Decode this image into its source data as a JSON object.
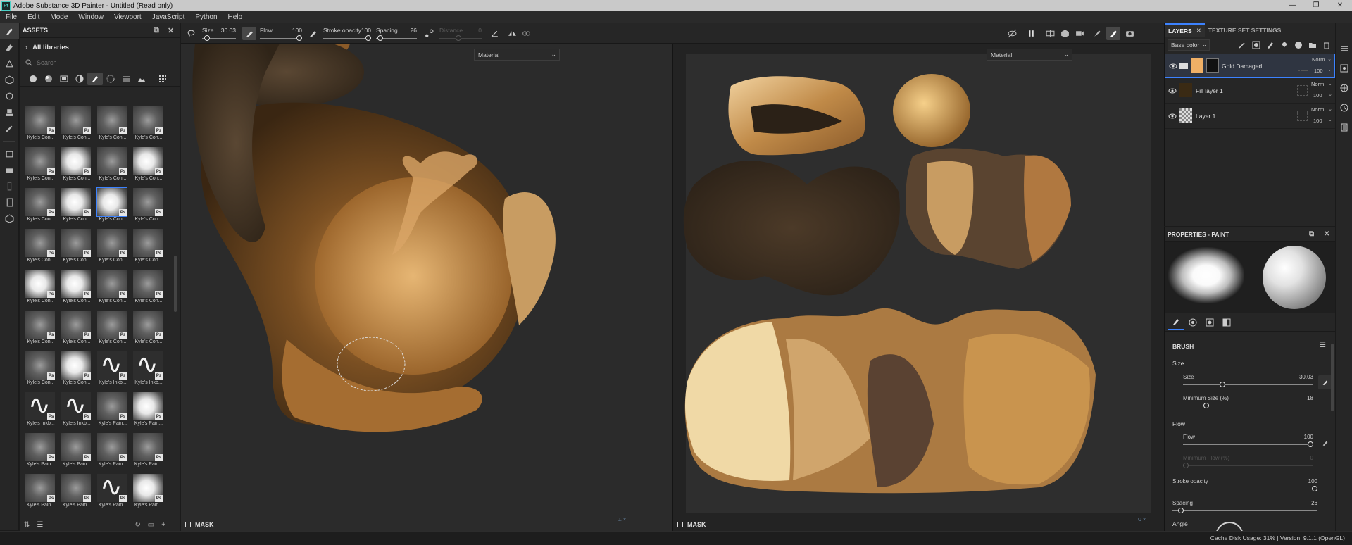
{
  "window": {
    "title": "Adobe Substance 3D Painter - Untitled (Read only)",
    "app_icon": "Pt",
    "controls": [
      "—",
      "❐",
      "✕"
    ]
  },
  "menu": [
    "File",
    "Edit",
    "Mode",
    "Window",
    "Viewport",
    "JavaScript",
    "Python",
    "Help"
  ],
  "assets": {
    "title": "ASSETS",
    "library": "All libraries",
    "search_placeholder": "Search",
    "ps_badge": "Ps",
    "rows": [
      [
        "Kyle's Con...",
        "Kyle's Con...",
        "Kyle's Con...",
        "Kyle's Con..."
      ],
      [
        "Kyle's Con...",
        "Kyle's Con...",
        "Kyle's Con...",
        "Kyle's Con..."
      ],
      [
        "Kyle's Con...",
        "Kyle's Con...",
        "Kyle's Con...",
        "Kyle's Con..."
      ],
      [
        "Kyle's Con...",
        "Kyle's Con...",
        "Kyle's Con...",
        "Kyle's Con..."
      ],
      [
        "Kyle's Con...",
        "Kyle's Con...",
        "Kyle's Con...",
        "Kyle's Con..."
      ],
      [
        "Kyle's Con...",
        "Kyle's Con...",
        "Kyle's Con...",
        "Kyle's Con..."
      ],
      [
        "Kyle's Con...",
        "Kyle's Con...",
        "Kyle's Inkb...",
        "Kyle's Inkb..."
      ],
      [
        "Kyle's Inkb...",
        "Kyle's Inkb...",
        "Kyle's Pain...",
        "Kyle's Pain..."
      ],
      [
        "Kyle's Pain...",
        "Kyle's Pain...",
        "Kyle's Pain...",
        "Kyle's Pain..."
      ],
      [
        "Kyle's Pain...",
        "Kyle's Pain...",
        "Kyle's Pain...",
        "Kyle's Pain..."
      ]
    ]
  },
  "toolbar": {
    "size": {
      "label": "Size",
      "value": "30.03",
      "fraction": 0.15
    },
    "flow": {
      "label": "Flow",
      "value": "100",
      "fraction": 1.0
    },
    "stroke_opacity": {
      "label": "Stroke opacity",
      "value": "100",
      "fraction": 1.0
    },
    "spacing": {
      "label": "Spacing",
      "value": "26",
      "fraction": 0.1
    },
    "distance": {
      "label": "Distance",
      "value": "0",
      "fraction": 0.45
    }
  },
  "viewport3d": {
    "dropdown": "Material",
    "mask": "MASK"
  },
  "viewport2d": {
    "dropdown": "Material",
    "mask": "MASK"
  },
  "layers": {
    "tab_layers": "LAYERS",
    "tab_texture": "TEXTURE SET SETTINGS",
    "channel": "Base color",
    "items": [
      {
        "name": "Gold Damaged",
        "blend": "Norm",
        "opacity": "100",
        "swatch": "#f0b066"
      },
      {
        "name": "Fill layer 1",
        "blend": "Norm",
        "opacity": "100",
        "swatch": "#3a2a14"
      },
      {
        "name": "Layer 1",
        "blend": "Norm",
        "opacity": "100",
        "swatch": "checker"
      }
    ]
  },
  "properties": {
    "title": "PROPERTIES - PAINT",
    "brush_section": "BRUSH",
    "size_group": "Size",
    "size": {
      "label": "Size",
      "value": "30.03",
      "fraction": 0.3
    },
    "min_size": {
      "label": "Minimum Size (%)",
      "value": "18",
      "fraction": 0.18
    },
    "flow_group": "Flow",
    "flow": {
      "label": "Flow",
      "value": "100",
      "fraction": 1.0
    },
    "min_flow": {
      "label": "Minimum Flow (%)",
      "value": "0",
      "fraction": 0.0
    },
    "stroke_opacity": {
      "label": "Stroke opacity",
      "value": "100",
      "fraction": 1.0
    },
    "spacing": {
      "label": "Spacing",
      "value": "26",
      "fraction": 0.06
    },
    "angle": {
      "label": "Angle"
    }
  },
  "status": {
    "text": "Cache Disk Usage:   31% | Version: 9.1.1 (OpenGL)"
  },
  "colors": {
    "accent": "#3c82ff",
    "gold": "#d9a566"
  }
}
